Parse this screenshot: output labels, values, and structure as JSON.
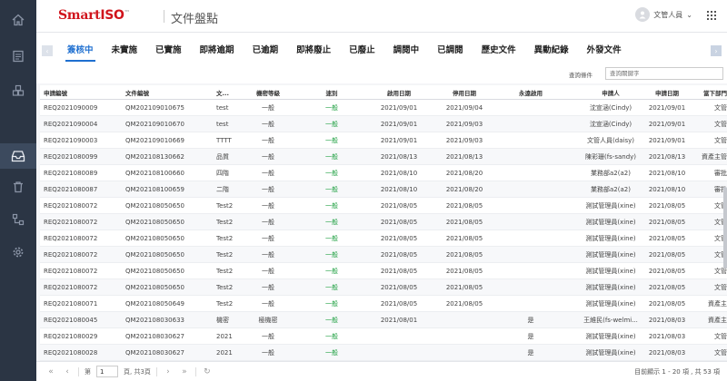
{
  "sidebar": {
    "icons": [
      "home-icon",
      "document-list-icon",
      "blocks-icon",
      "inbox-icon",
      "trash-icon",
      "flow-icon",
      "gear-icon"
    ],
    "active_index": 3
  },
  "header": {
    "logo_smart": "Smart",
    "logo_iso": "ISO",
    "logo_tm": "™",
    "page_title": "文件盤點",
    "user_name": "文管人員"
  },
  "tabs": [
    "簽核中",
    "未實施",
    "已實施",
    "即將逾期",
    "已逾期",
    "即將廢止",
    "已廢止",
    "調閱中",
    "已調閱",
    "歷史文件",
    "異動紀錄",
    "外發文件"
  ],
  "active_tab": 0,
  "search": {
    "label": "查詢條件",
    "placeholder": "查詢關鍵字"
  },
  "table": {
    "columns": [
      "申請編號",
      "文件編號",
      "文...",
      "機密等級",
      "速別",
      "啟用日期",
      "停用日期",
      "永遠啟用",
      "申請人",
      "申請日期",
      "當下部門"
    ],
    "rows": [
      [
        "REQ2021090009",
        "QM202109010675",
        "test",
        "一般",
        "一般",
        "2021/09/01",
        "2021/09/04",
        "",
        "沈宣涵(Cindy)",
        "2021/09/01",
        "文管"
      ],
      [
        "REQ2021090004",
        "QM202109010670",
        "test",
        "一般",
        "一般",
        "2021/09/01",
        "2021/09/03",
        "",
        "沈宣涵(Cindy)",
        "2021/09/01",
        "文管"
      ],
      [
        "REQ2021090003",
        "QM202109010669",
        "TTTT",
        "一般",
        "一般",
        "2021/09/01",
        "2021/09/03",
        "",
        "文管人員(daisy)",
        "2021/09/01",
        "文管"
      ],
      [
        "REQ2021080099",
        "QM202108130662",
        "品質",
        "一般",
        "一般",
        "2021/08/13",
        "2021/08/13",
        "",
        "陳彩珊(fs-sandy)",
        "2021/08/13",
        "資產主管"
      ],
      [
        "REQ2021080089",
        "QM202108100660",
        "四階",
        "一般",
        "一般",
        "2021/08/10",
        "2021/08/20",
        "",
        "業務部a2(a2)",
        "2021/08/10",
        "審批"
      ],
      [
        "REQ2021080087",
        "QM202108100659",
        "二階",
        "一般",
        "一般",
        "2021/08/10",
        "2021/08/20",
        "",
        "業務部a2(a2)",
        "2021/08/10",
        "審批"
      ],
      [
        "REQ2021080072",
        "QM202108050650",
        "Test2",
        "一般",
        "一般",
        "2021/08/05",
        "2021/08/05",
        "",
        "測試管理員(xine)",
        "2021/08/05",
        "文管"
      ],
      [
        "REQ2021080072",
        "QM202108050650",
        "Test2",
        "一般",
        "一般",
        "2021/08/05",
        "2021/08/05",
        "",
        "測試管理員(xine)",
        "2021/08/05",
        "文管"
      ],
      [
        "REQ2021080072",
        "QM202108050650",
        "Test2",
        "一般",
        "一般",
        "2021/08/05",
        "2021/08/05",
        "",
        "測試管理員(xine)",
        "2021/08/05",
        "文管"
      ],
      [
        "REQ2021080072",
        "QM202108050650",
        "Test2",
        "一般",
        "一般",
        "2021/08/05",
        "2021/08/05",
        "",
        "測試管理員(xine)",
        "2021/08/05",
        "文管"
      ],
      [
        "REQ2021080072",
        "QM202108050650",
        "Test2",
        "一般",
        "一般",
        "2021/08/05",
        "2021/08/05",
        "",
        "測試管理員(xine)",
        "2021/08/05",
        "文管"
      ],
      [
        "REQ2021080072",
        "QM202108050650",
        "Test2",
        "一般",
        "一般",
        "2021/08/05",
        "2021/08/05",
        "",
        "測試管理員(xine)",
        "2021/08/05",
        "文管"
      ],
      [
        "REQ2021080071",
        "QM202108050649",
        "Test2",
        "一般",
        "一般",
        "2021/08/05",
        "2021/08/05",
        "",
        "測試管理員(xine)",
        "2021/08/05",
        "資產主"
      ],
      [
        "REQ2021080045",
        "QM202108030633",
        "機密",
        "極機密",
        "一般",
        "2021/08/01",
        "",
        "是",
        "王維民(fs-welmi...",
        "2021/08/03",
        "資產主"
      ],
      [
        "REQ2021080029",
        "QM202108030627",
        "2021",
        "一般",
        "一般",
        "",
        "",
        "是",
        "測試管理員(xine)",
        "2021/08/03",
        "文管"
      ],
      [
        "REQ2021080028",
        "QM202108030627",
        "2021",
        "一般",
        "一般",
        "",
        "",
        "是",
        "測試管理員(xine)",
        "2021/08/03",
        "文管"
      ]
    ]
  },
  "pager": {
    "page_label": "第",
    "page_value": "1",
    "page_total": "頁, 共3頁",
    "info": "目前顯示 1 - 20 項 , 共 53 項"
  },
  "colors": {
    "sidebar_bg": "#2b3544",
    "accent": "#1e6fd0",
    "speed_green": "#1b9e3e",
    "logo_red": "#d0141c"
  }
}
